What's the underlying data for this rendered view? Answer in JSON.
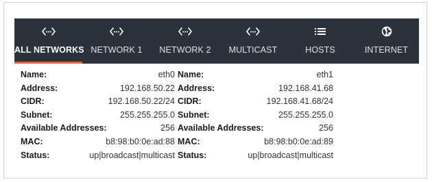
{
  "tabs": [
    {
      "label": "ALL NETWORKS",
      "icon": "network-code-icon",
      "active": true
    },
    {
      "label": "NETWORK 1",
      "icon": "network-code-icon",
      "active": false
    },
    {
      "label": "NETWORK 2",
      "icon": "network-code-icon",
      "active": false
    },
    {
      "label": "MULTICAST",
      "icon": "network-code-icon",
      "active": false
    },
    {
      "label": "HOSTS",
      "icon": "list-icon",
      "active": false
    },
    {
      "label": "INTERNET",
      "icon": "globe-icon",
      "active": false
    }
  ],
  "colors": {
    "tabbar_bg": "#2a323c",
    "active_underline": "#e8663c"
  },
  "networks": [
    {
      "name_label": "Name:",
      "name": "eth0",
      "address_label": "Address:",
      "address": "192.168.50.22",
      "cidr_label": "CIDR:",
      "cidr": "192.168.50.22/24",
      "subnet_label": "Subnet:",
      "subnet": "255.255.255.0",
      "available_label": "Available Addresses:",
      "available": "256",
      "mac_label": "MAC:",
      "mac": "b8:98:b0:0e:ad:88",
      "status_label": "Status:",
      "status": "up|broadcast|multicast"
    },
    {
      "name_label": "Name:",
      "name": "eth1",
      "address_label": "Address:",
      "address": "192.168.41.68",
      "cidr_label": "CIDR:",
      "cidr": "192.168.41.68/24",
      "subnet_label": "Subnet:",
      "subnet": "255.255.255.0",
      "available_label": "Available Addresses:",
      "available": "256",
      "mac_label": "MAC:",
      "mac": "b8:98:b0:0e:ad:89",
      "status_label": "Status:",
      "status": "up|broadcast|multicast"
    }
  ]
}
